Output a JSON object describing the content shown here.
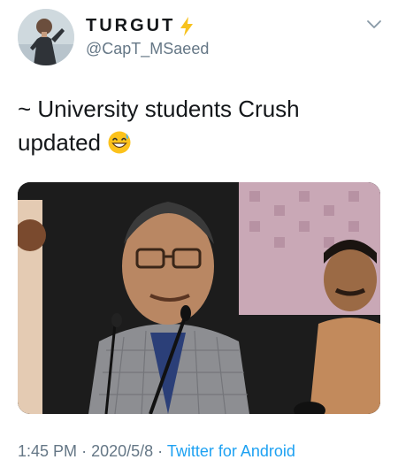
{
  "user": {
    "display_name": "TURGUT",
    "handle": "@CapT_MSaeed",
    "badge_icon": "lightning-bolt-icon",
    "badge_color": "#f7c21e"
  },
  "tweet": {
    "text": "~ University students Crush updated",
    "emoji_icon": "grinning-face-with-sweat-emoji"
  },
  "media": {
    "kind": "photo"
  },
  "footer": {
    "time": "1:45 PM",
    "date": "2020/5/8",
    "separator": "·",
    "source": "Twitter for Android"
  },
  "colors": {
    "text": "#14171a",
    "secondary": "#657786",
    "link": "#1da1f2"
  }
}
